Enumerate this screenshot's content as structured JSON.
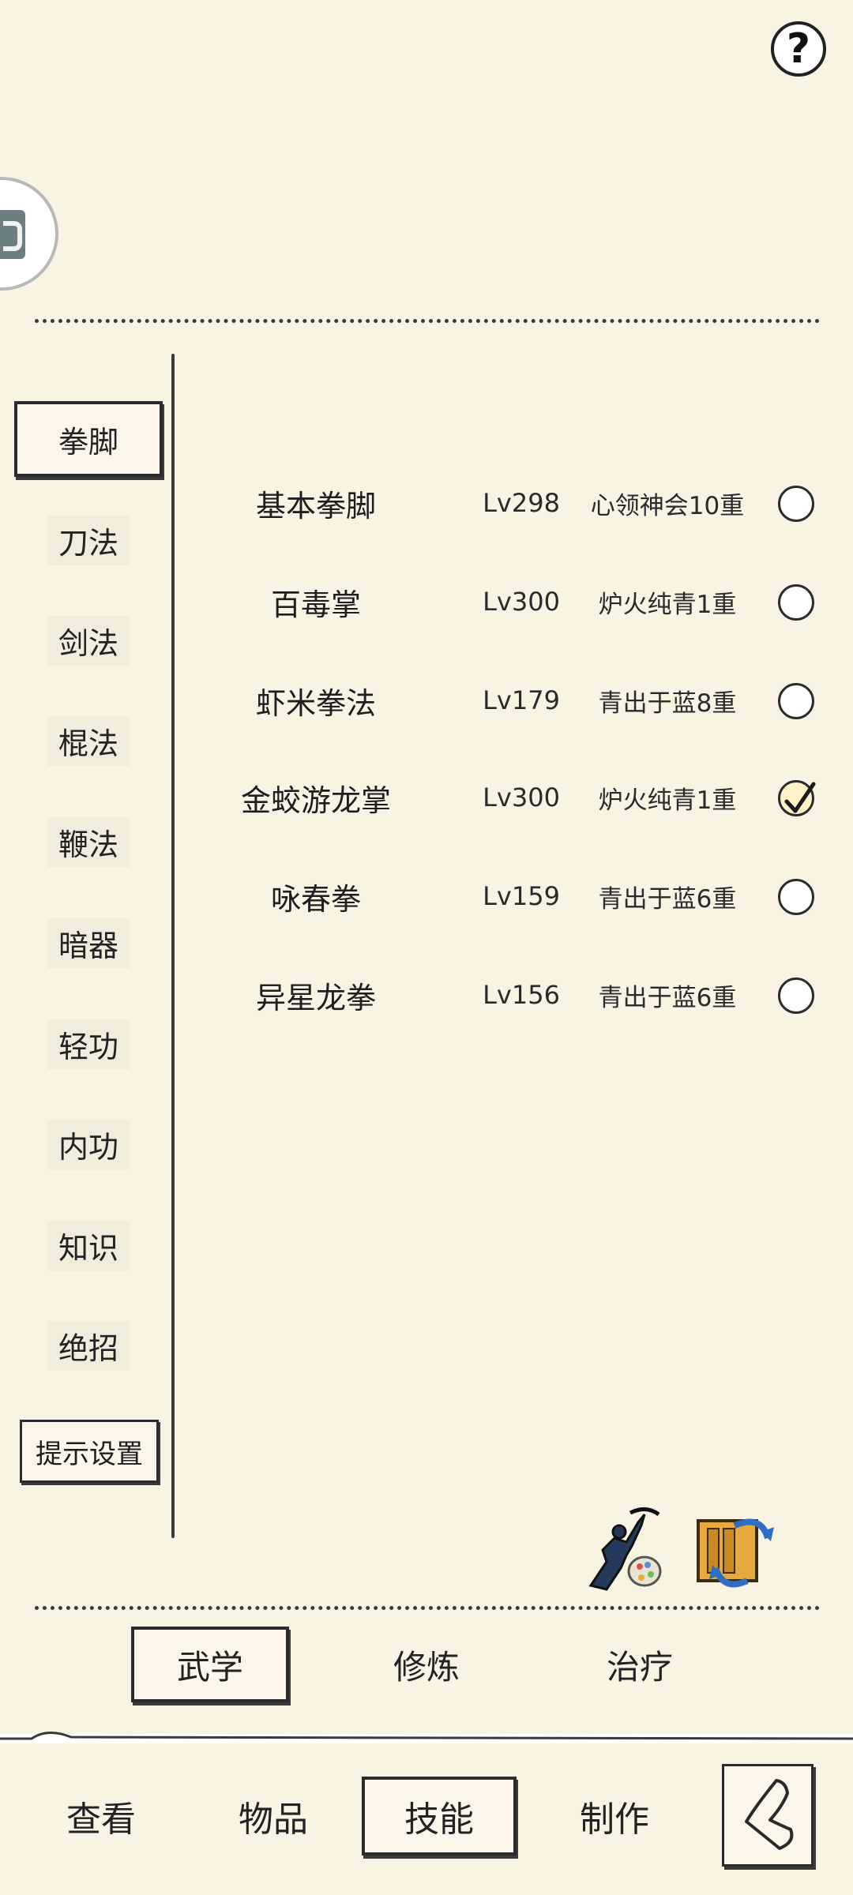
{
  "header": {
    "help_label": "?"
  },
  "categories": [
    {
      "label": "拳脚",
      "active": true
    },
    {
      "label": "刀法"
    },
    {
      "label": "剑法"
    },
    {
      "label": "棍法"
    },
    {
      "label": "鞭法"
    },
    {
      "label": "暗器"
    },
    {
      "label": "轻功"
    },
    {
      "label": "内功"
    },
    {
      "label": "知识"
    },
    {
      "label": "绝招"
    }
  ],
  "tip_settings_label": "提示设置",
  "skills": [
    {
      "name": "基本拳脚",
      "level": "Lv298",
      "rank": "心领神会10重",
      "checked": false
    },
    {
      "name": "百毒掌",
      "level": "Lv300",
      "rank": "炉火纯青1重",
      "checked": false
    },
    {
      "name": "虾米拳法",
      "level": "Lv179",
      "rank": "青出于蓝8重",
      "checked": false
    },
    {
      "name": "金蛟游龙掌",
      "level": "Lv300",
      "rank": "炉火纯青1重",
      "checked": true
    },
    {
      "name": "咏春拳",
      "level": "Lv159",
      "rank": "青出于蓝6重",
      "checked": false
    },
    {
      "name": "异星龙拳",
      "level": "Lv156",
      "rank": "青出于蓝6重",
      "checked": false
    }
  ],
  "sub_tabs": [
    {
      "label": "武学",
      "active": true
    },
    {
      "label": "修炼"
    },
    {
      "label": "治疗"
    }
  ],
  "bottom_nav": [
    {
      "label": "查看"
    },
    {
      "label": "物品"
    },
    {
      "label": "技能",
      "active": true
    },
    {
      "label": "制作"
    }
  ],
  "icons": {
    "help": "question-mark-icon",
    "martial_customize": "martial-artist-palette-icon",
    "scroll_swap": "scroll-swap-icon",
    "back": "back-arrow-icon"
  }
}
